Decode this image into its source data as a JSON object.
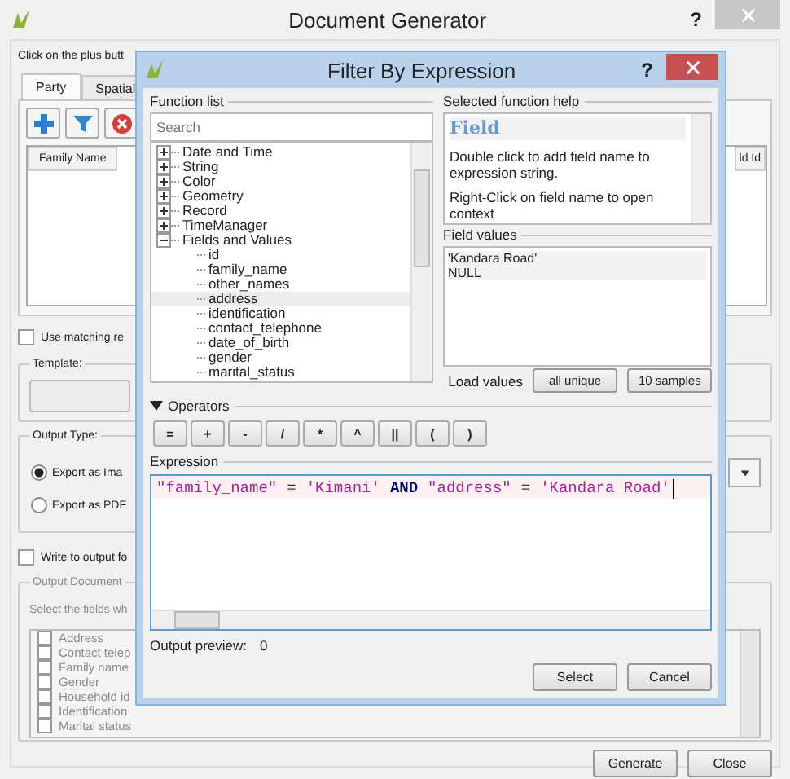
{
  "window": {
    "title": "Document Generator",
    "help": "?"
  },
  "instruction": "Click on the plus butt",
  "tabs": [
    {
      "label": "Party",
      "selected": true
    },
    {
      "label": "Spatial",
      "selected": false
    }
  ],
  "table": {
    "columns": [
      "Family Name",
      "ld Id"
    ]
  },
  "use_matching": {
    "label": "Use matching re",
    "checked": false
  },
  "template": {
    "title": "Template:"
  },
  "output_type": {
    "title": "Output Type:",
    "options": [
      {
        "label": "Export as Ima",
        "selected": true
      },
      {
        "label": "Export as PDF",
        "selected": false
      }
    ]
  },
  "write_output": {
    "label": "Write to output fo",
    "checked": false
  },
  "output_naming": {
    "title": "Output Document",
    "hint": "Select the fields wh",
    "disabled": true,
    "fields": [
      {
        "label": "Address",
        "checked": false
      },
      {
        "label": "Contact telep",
        "checked": false
      },
      {
        "label": "Family name",
        "checked": false
      },
      {
        "label": "Gender",
        "checked": false
      },
      {
        "label": "Household id",
        "checked": false
      },
      {
        "label": "Identification",
        "checked": false
      },
      {
        "label": "Marital status",
        "checked": false
      }
    ]
  },
  "buttons": [
    "Generate",
    "Close"
  ],
  "dialog": {
    "title": "Filter By Expression",
    "help": "?",
    "function_list": {
      "title": "Function list",
      "placeholder": "Search",
      "tree": [
        {
          "label": "Date and Time",
          "expanded": false,
          "selected": false
        },
        {
          "label": "String",
          "expanded": false,
          "selected": false
        },
        {
          "label": "Color",
          "expanded": false,
          "selected": false
        },
        {
          "label": "Geometry",
          "expanded": false,
          "selected": false
        },
        {
          "label": "Record",
          "expanded": false,
          "selected": false
        },
        {
          "label": "TimeManager",
          "expanded": false,
          "selected": false
        },
        {
          "label": "Fields and Values",
          "expanded": true,
          "selected": false,
          "children": [
            {
              "label": "id",
              "selected": false
            },
            {
              "label": "family_name",
              "selected": false
            },
            {
              "label": "other_names",
              "selected": false
            },
            {
              "label": "address",
              "selected": true
            },
            {
              "label": "identification",
              "selected": false
            },
            {
              "label": "contact_telephone",
              "selected": false
            },
            {
              "label": "date_of_birth",
              "selected": false
            },
            {
              "label": "gender",
              "selected": false
            },
            {
              "label": "marital_status",
              "selected": false
            }
          ]
        }
      ]
    },
    "help_panel": {
      "title": "Selected function help",
      "heading": "Field",
      "paragraphs": [
        "Double click to add field name to expression string.",
        "Right-Click on field name to open context"
      ]
    },
    "field_values": {
      "title": "Field values",
      "items": [
        "'Kandara Road'",
        "NULL"
      ]
    },
    "load_values": {
      "label": "Load values",
      "buttons": [
        "all unique",
        "10 samples"
      ]
    },
    "operators": {
      "title": "Operators",
      "expanded": true,
      "items": [
        "=",
        "+",
        "-",
        "/",
        "*",
        "^",
        "||",
        "(",
        ")"
      ]
    },
    "expression": {
      "title": "Expression",
      "tokens": [
        {
          "kind": "field",
          "text": "\"family_name\""
        },
        {
          "kind": "operator",
          "text": "="
        },
        {
          "kind": "string",
          "text": "'Kimani'"
        },
        {
          "kind": "keyword",
          "text": "AND"
        },
        {
          "kind": "field",
          "text": "\"address\""
        },
        {
          "kind": "operator",
          "text": "="
        },
        {
          "kind": "string",
          "text": "'Kandara Road'"
        }
      ]
    },
    "preview": {
      "label": "Output preview:",
      "value": "0"
    },
    "buttons": [
      "Select",
      "Cancel"
    ]
  }
}
